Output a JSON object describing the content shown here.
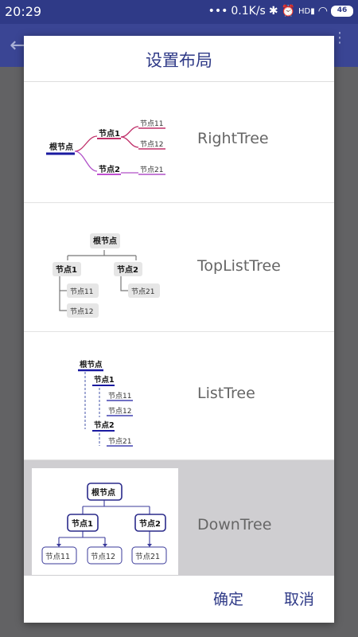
{
  "status_bar": {
    "time": "20:29",
    "dots": "•••",
    "speed": "0.1K/s",
    "signal": "HD",
    "battery": "46"
  },
  "dialog": {
    "title": "设置布局",
    "confirm_label": "确定",
    "cancel_label": "取消",
    "options": [
      {
        "label": "RightTree",
        "selected": false
      },
      {
        "label": "TopListTree",
        "selected": false
      },
      {
        "label": "ListTree",
        "selected": false
      },
      {
        "label": "DownTree",
        "selected": true
      }
    ]
  },
  "tree_nodes": {
    "root": "根节点",
    "n1": "节点1",
    "n2": "节点2",
    "n11": "节点11",
    "n12": "节点12",
    "n21": "节点21"
  },
  "colors": {
    "accent": "#2f3a87",
    "selected_bg": "#cfced1"
  }
}
